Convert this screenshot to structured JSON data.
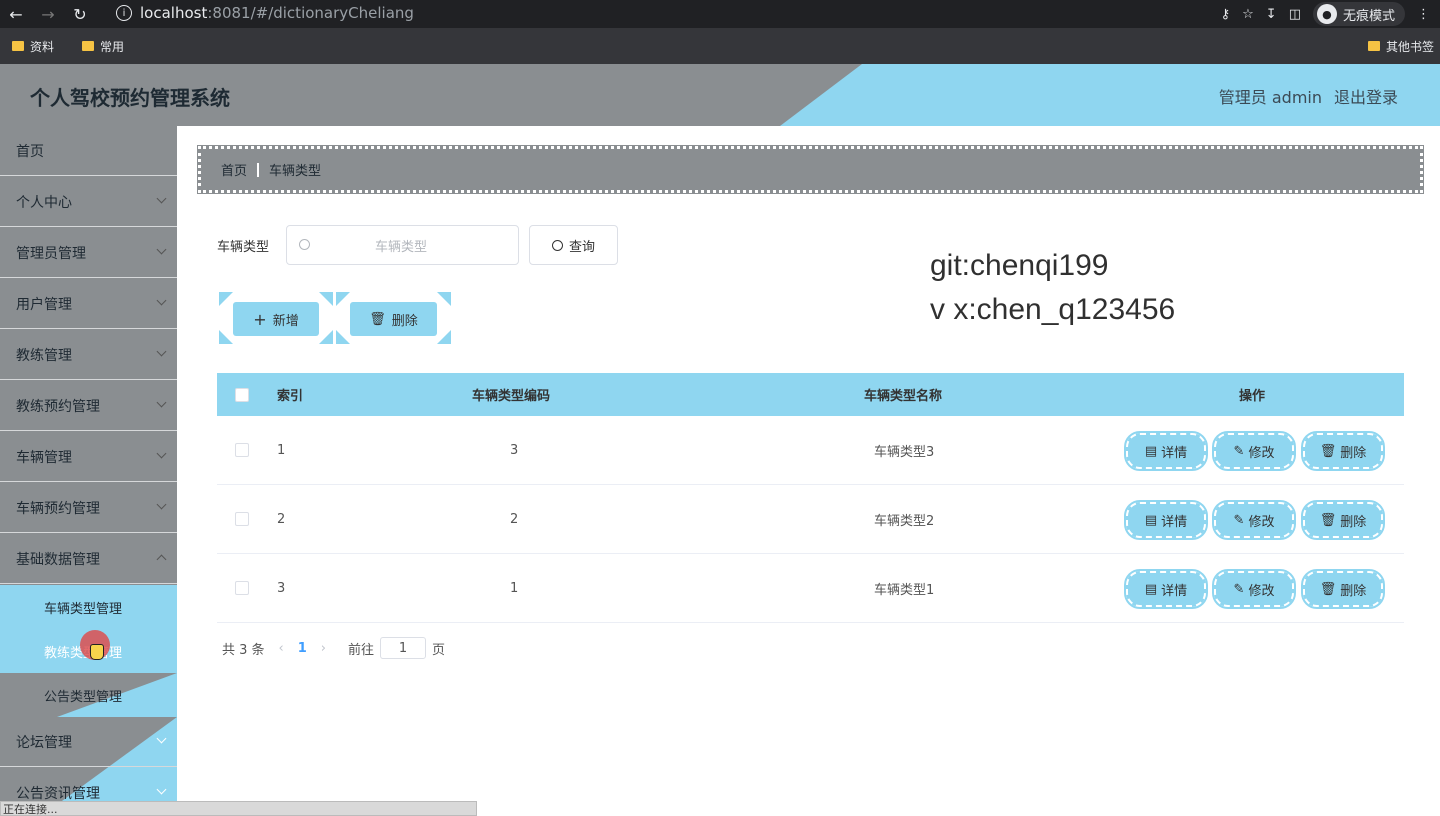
{
  "browser": {
    "url_host": "localhost",
    "url_path": ":8081/#/dictionaryCheliang",
    "incognito_label": "无痕模式",
    "bookmarks": [
      "资料",
      "常用"
    ],
    "other_bookmarks": "其他书签",
    "status": "正在连接..."
  },
  "header": {
    "title": "个人驾校预约管理系统",
    "user": "管理员 admin",
    "logout": "退出登录"
  },
  "sidebar": {
    "items": [
      {
        "label": "首页"
      },
      {
        "label": "个人中心"
      },
      {
        "label": "管理员管理"
      },
      {
        "label": "用户管理"
      },
      {
        "label": "教练管理"
      },
      {
        "label": "教练预约管理"
      },
      {
        "label": "车辆管理"
      },
      {
        "label": "车辆预约管理"
      },
      {
        "label": "基础数据管理"
      }
    ],
    "sub_items": [
      {
        "label": "车辆类型管理"
      },
      {
        "label": "教练类型管理"
      },
      {
        "label": "公告类型管理"
      }
    ],
    "lower_items": [
      {
        "label": "论坛管理"
      },
      {
        "label": "公告资讯管理"
      }
    ]
  },
  "breadcrumb": {
    "home": "首页",
    "current": "车辆类型"
  },
  "search": {
    "label": "车辆类型",
    "placeholder": "车辆类型",
    "button": "查询"
  },
  "watermark": {
    "line1": "git:chenqi199",
    "line2": "v x:chen_q123456"
  },
  "actions": {
    "add": "新增",
    "delete": "删除"
  },
  "table": {
    "headers": [
      "索引",
      "车辆类型编码",
      "车辆类型名称",
      "操作"
    ],
    "rows": [
      {
        "index": "1",
        "code": "3",
        "name": "车辆类型3"
      },
      {
        "index": "2",
        "code": "2",
        "name": "车辆类型2"
      },
      {
        "index": "3",
        "code": "1",
        "name": "车辆类型1"
      }
    ],
    "row_actions": {
      "detail": "详情",
      "edit": "修改",
      "delete": "删除"
    }
  },
  "pagination": {
    "total": "共 3 条",
    "current": "1",
    "goto": "前往",
    "page_value": "1",
    "page_suffix": "页"
  },
  "colors": {
    "accent": "#8fd6f0",
    "grey": "#8a8e91"
  }
}
